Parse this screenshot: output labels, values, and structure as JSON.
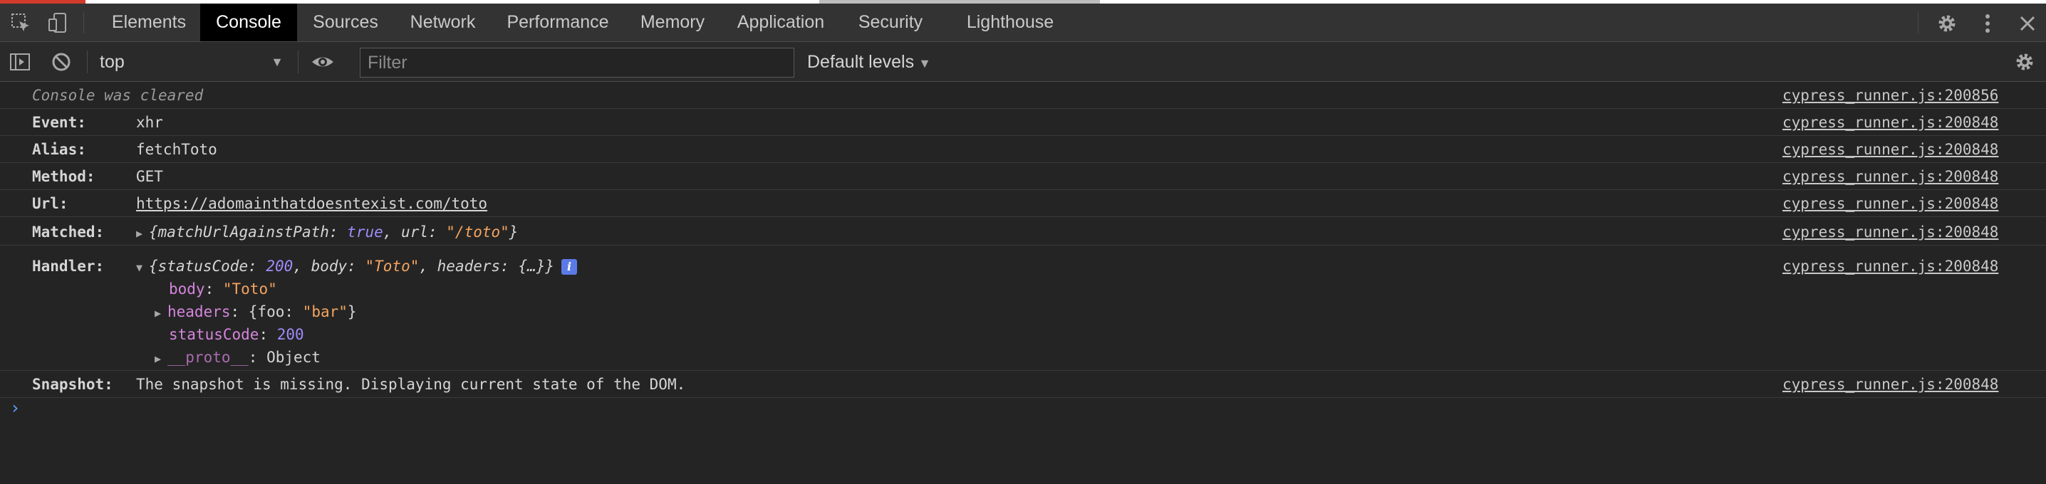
{
  "tabs": [
    {
      "label": "Elements",
      "active": false
    },
    {
      "label": "Console",
      "active": true
    },
    {
      "label": "Sources",
      "active": false
    },
    {
      "label": "Network",
      "active": false
    },
    {
      "label": "Performance",
      "active": false
    },
    {
      "label": "Memory",
      "active": false
    },
    {
      "label": "Application",
      "active": false
    },
    {
      "label": "Security",
      "active": false
    },
    {
      "label": "Lighthouse",
      "active": false
    }
  ],
  "toolbar": {
    "context": "top",
    "filter_placeholder": "Filter",
    "filter_value": "",
    "levels": "Default levels"
  },
  "icons": {
    "inspect": "inspect-element-icon",
    "device": "device-toolbar-icon",
    "sidebar": "show-sidebar-icon",
    "clear": "clear-console-icon",
    "eye": "live-expression-eye-icon",
    "settings": "gear-icon",
    "more": "kebab-menu-icon",
    "close": "close-icon"
  },
  "colors": {
    "active_tab_bg": "#000000",
    "tabbar_bg": "#333333",
    "console_bg": "#242424",
    "keyword_purple": "#a08bf8",
    "string_orange": "#f4a45f",
    "property_pink": "#d585dd",
    "info_badge": "#5c7ae6",
    "prompt_blue": "#5da2ff"
  },
  "messages": {
    "cleared": {
      "text": "Console was cleared",
      "source": "cypress_runner.js:200856"
    },
    "event": {
      "label": "Event:",
      "value": "xhr",
      "source": "cypress_runner.js:200848"
    },
    "alias": {
      "label": "Alias:",
      "value": "fetchToto",
      "source": "cypress_runner.js:200848"
    },
    "method": {
      "label": "Method:",
      "value": "GET",
      "source": "cypress_runner.js:200848"
    },
    "url": {
      "label": "Url:",
      "value": "https://adomainthatdoesntexist.com/toto",
      "source": "cypress_runner.js:200848"
    },
    "matched": {
      "label": "Matched:",
      "k1": "matchUrlAgainstPath",
      "v1": "true",
      "k2": "url",
      "v2": "\"/toto\"",
      "source": "cypress_runner.js:200848"
    },
    "handler": {
      "label": "Handler:",
      "summary": {
        "k1": "statusCode",
        "v1": "200",
        "k2": "body",
        "v2": "\"Toto\"",
        "k3": "headers",
        "v3": "{…}"
      },
      "info": "i",
      "body": {
        "key": "body",
        "value": "\"Toto\""
      },
      "headers": {
        "key": "headers",
        "inner_key": "foo",
        "inner_value": "\"bar\""
      },
      "statusCode": {
        "key": "statusCode",
        "value": "200"
      },
      "proto": {
        "key": "__proto__",
        "value": "Object"
      },
      "source": "cypress_runner.js:200848"
    },
    "snapshot": {
      "label": "Snapshot:",
      "value": "The snapshot is missing. Displaying current state of the DOM.",
      "source": "cypress_runner.js:200848"
    }
  },
  "prompt": "›"
}
